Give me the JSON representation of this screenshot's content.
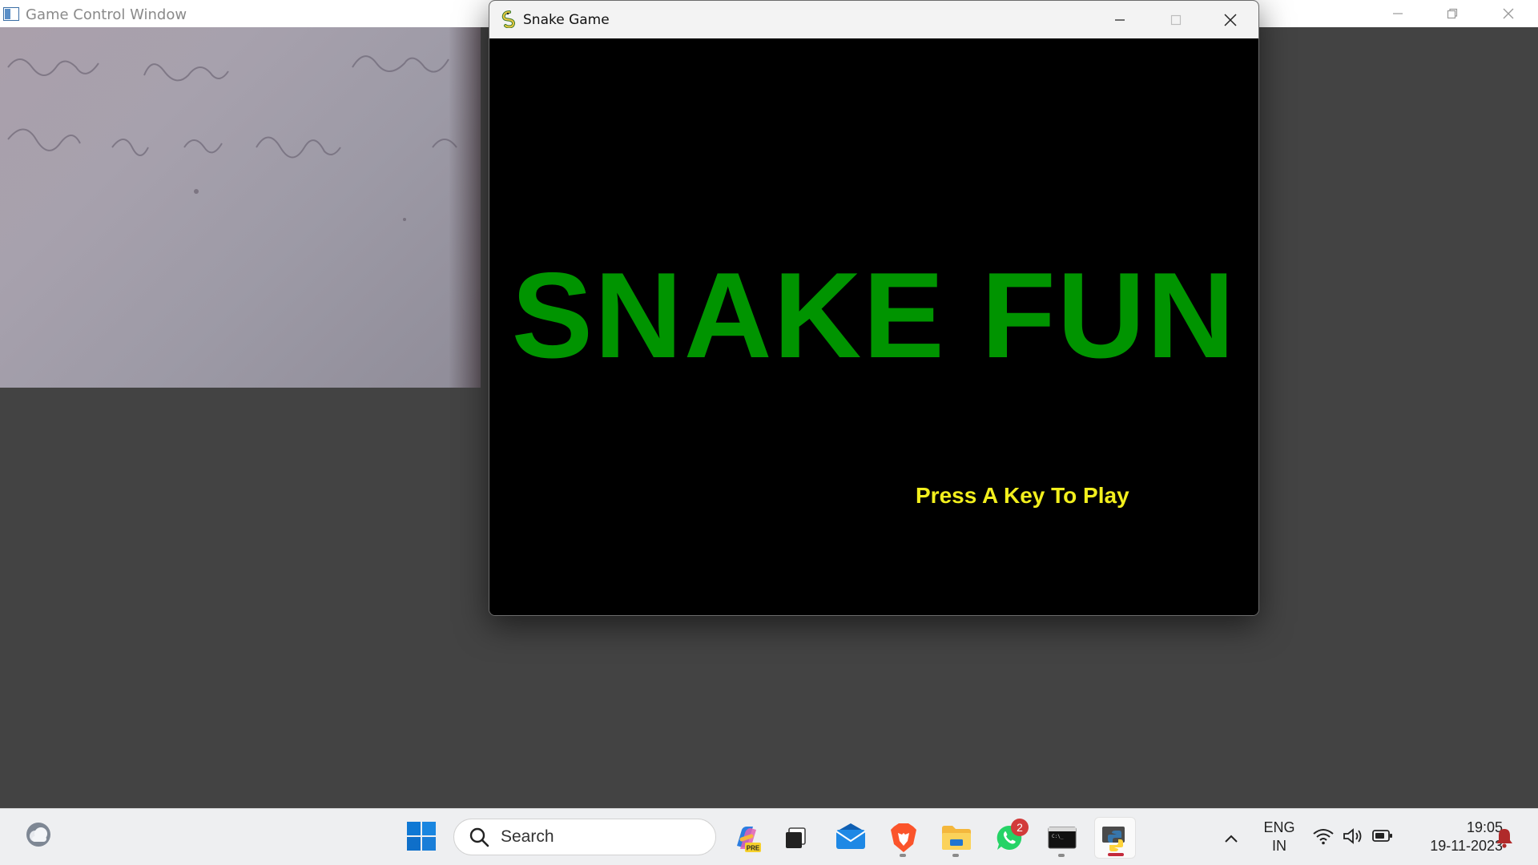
{
  "control_window": {
    "title": "Game Control Window",
    "icon": "app-window-icon",
    "buttons": [
      "minimize-icon",
      "restore-icon",
      "close-icon"
    ]
  },
  "snake_window": {
    "title": "Snake Game",
    "icon": "pygame-snake-icon",
    "buttons": [
      "minimize-icon",
      "maximize-icon",
      "close-icon"
    ],
    "game_title": "SNAKE FUN",
    "prompt": "Press A Key To Play",
    "colors": {
      "background": "#000000",
      "title": "#009400",
      "prompt": "#f2ef1d"
    }
  },
  "taskbar": {
    "search_placeholder": "Search",
    "apps": [
      {
        "name": "copilot-pre",
        "icon": "copilot-icon",
        "label": "PRE"
      },
      {
        "name": "task-view",
        "icon": "task-view-icon"
      },
      {
        "name": "mail",
        "icon": "mail-icon"
      },
      {
        "name": "brave",
        "icon": "brave-icon"
      },
      {
        "name": "file-explorer",
        "icon": "folder-icon"
      },
      {
        "name": "whatsapp",
        "icon": "whatsapp-icon",
        "badge": "2"
      },
      {
        "name": "terminal",
        "icon": "terminal-icon"
      },
      {
        "name": "python",
        "icon": "python-icon"
      }
    ],
    "tray": {
      "lang_line1": "ENG",
      "lang_line2": "IN",
      "time": "19:05",
      "date": "19-11-2023"
    }
  }
}
